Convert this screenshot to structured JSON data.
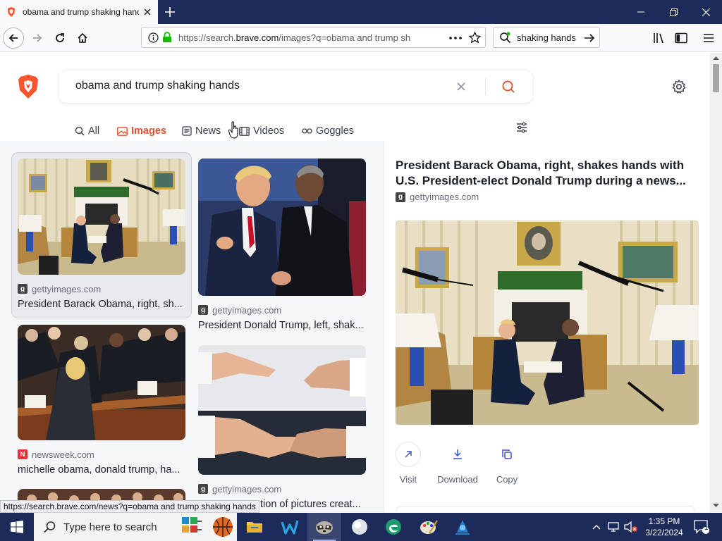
{
  "browser": {
    "tab_title": "obama and trump shaking hands",
    "url_prefix": "https://search.",
    "url_host": "brave.com",
    "url_rest": "/images?q=obama and trump sh",
    "search_box_text": "shaking hands"
  },
  "search": {
    "query": "obama and trump shaking hands"
  },
  "tabs": [
    {
      "label": "All"
    },
    {
      "label": "Images"
    },
    {
      "label": "News"
    },
    {
      "label": "Videos"
    },
    {
      "label": "Goggles"
    }
  ],
  "results": [
    {
      "source": "gettyimages.com",
      "caption": "President Barack Obama, right, sh..."
    },
    {
      "source": "gettyimages.com",
      "caption": "President Donald Trump, left, shak..."
    },
    {
      "source": "newsweek.com",
      "caption": "michelle obama, donald trump, ha..."
    },
    {
      "source": "gettyimages.com",
      "caption": "tion of pictures creat..."
    }
  ],
  "detail": {
    "title": "President Barack Obama, right, shakes hands with U.S. President-elect Donald Trump during a news...",
    "source": "gettyimages.com",
    "actions": [
      {
        "label": "Visit"
      },
      {
        "label": "Download"
      },
      {
        "label": "Copy"
      }
    ]
  },
  "status_bar": {
    "link": "https://search.brave.com/news?q=obama and trump shaking hands"
  },
  "taskbar": {
    "search_placeholder": "Type here to search",
    "time": "1:35 PM",
    "date": "3/22/2024",
    "notification_count": "1"
  },
  "colors": {
    "accent": "#e0502c",
    "chrome": "#1c2b5a",
    "getty": "#444444",
    "newsweek": "#e8303a"
  }
}
